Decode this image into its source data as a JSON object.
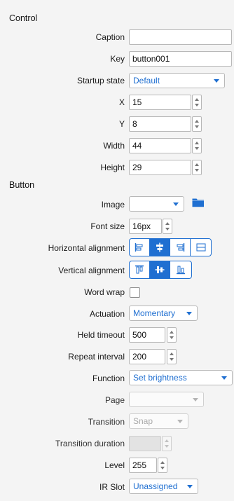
{
  "control": {
    "title": "Control",
    "caption": {
      "label": "Caption",
      "value": ""
    },
    "key": {
      "label": "Key",
      "value": "button001"
    },
    "startup_state": {
      "label": "Startup state",
      "value": "Default"
    },
    "x": {
      "label": "X",
      "value": "15"
    },
    "y": {
      "label": "Y",
      "value": "8"
    },
    "width": {
      "label": "Width",
      "value": "44"
    },
    "height": {
      "label": "Height",
      "value": "29"
    }
  },
  "button": {
    "title": "Button",
    "image": {
      "label": "Image",
      "value": ""
    },
    "font_size": {
      "label": "Font size",
      "value": "16px"
    },
    "horizontal_alignment": {
      "label": "Horizontal alignment",
      "selected": "center"
    },
    "vertical_alignment": {
      "label": "Vertical alignment",
      "selected": "center"
    },
    "word_wrap": {
      "label": "Word wrap",
      "checked": false
    },
    "actuation": {
      "label": "Actuation",
      "value": "Momentary"
    },
    "held_timeout": {
      "label": "Held timeout",
      "value": "500"
    },
    "repeat_interval": {
      "label": "Repeat interval",
      "value": "200"
    },
    "function": {
      "label": "Function",
      "value": "Set brightness"
    },
    "page": {
      "label": "Page",
      "value": ""
    },
    "transition": {
      "label": "Transition",
      "value": "Snap"
    },
    "transition_duration": {
      "label": "Transition duration",
      "value": ""
    },
    "level": {
      "label": "Level",
      "value": "255"
    },
    "ir_slot": {
      "label": "IR Slot",
      "value": "Unassigned"
    }
  },
  "colors": {
    "accent": "#1f6fd1",
    "background": "#f4f4f4"
  },
  "icons": {
    "image_browse": "folder-icon"
  }
}
